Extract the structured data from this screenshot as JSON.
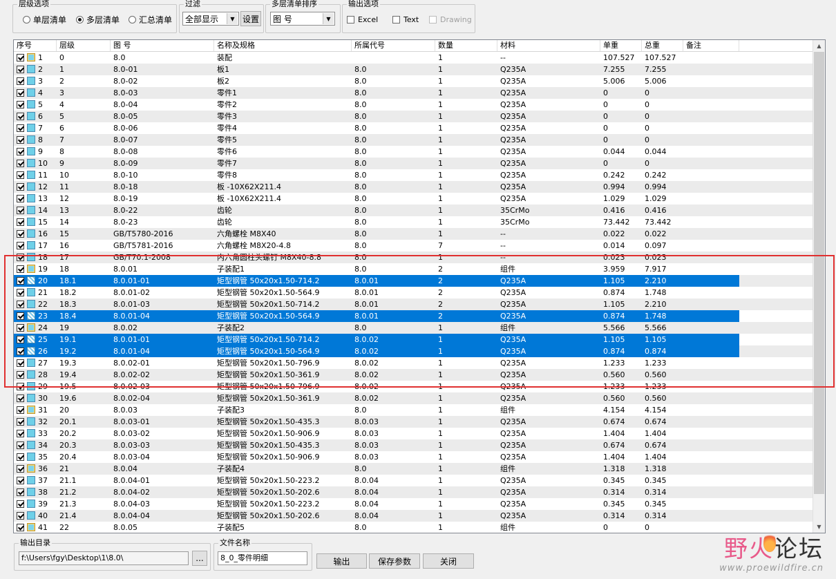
{
  "level_options": {
    "title": "层级选项",
    "options": [
      "单层清单",
      "多层清单",
      "汇总清单"
    ],
    "selected": "多层清单"
  },
  "filter": {
    "title": "过滤",
    "value": "全部显示",
    "button": "设置"
  },
  "sort": {
    "title": "多层清单排序",
    "value": "图 号"
  },
  "output_options": {
    "title": "输出选项",
    "items": [
      {
        "label": "Excel",
        "checked": false,
        "enabled": true
      },
      {
        "label": "Text",
        "checked": false,
        "enabled": true
      },
      {
        "label": "Drawing",
        "checked": false,
        "enabled": false
      }
    ]
  },
  "table": {
    "columns": [
      "序号",
      "层级",
      "图 号",
      "名称及规格",
      "所属代号",
      "数量",
      "材料",
      "单重",
      "总重",
      "备注"
    ],
    "rows": [
      {
        "no": "1",
        "level": "0",
        "dwg": "8.0",
        "name": "装配",
        "parent": "",
        "qty": "1",
        "mat": "--",
        "unit": "107.527",
        "total": "107.527",
        "note": "",
        "icon": "asm",
        "sel": false
      },
      {
        "no": "2",
        "level": "1",
        "dwg": "8.0-01",
        "name": "板1",
        "parent": "8.0",
        "qty": "1",
        "mat": "Q235A",
        "unit": "7.255",
        "total": "7.255",
        "note": "",
        "icon": "part",
        "sel": false
      },
      {
        "no": "3",
        "level": "2",
        "dwg": "8.0-02",
        "name": "板2",
        "parent": "8.0",
        "qty": "1",
        "mat": "Q235A",
        "unit": "5.006",
        "total": "5.006",
        "note": "",
        "icon": "part",
        "sel": false
      },
      {
        "no": "4",
        "level": "3",
        "dwg": "8.0-03",
        "name": "零件1",
        "parent": "8.0",
        "qty": "1",
        "mat": "Q235A",
        "unit": "0",
        "total": "0",
        "note": "",
        "icon": "part",
        "sel": false
      },
      {
        "no": "5",
        "level": "4",
        "dwg": "8.0-04",
        "name": "零件2",
        "parent": "8.0",
        "qty": "1",
        "mat": "Q235A",
        "unit": "0",
        "total": "0",
        "note": "",
        "icon": "part",
        "sel": false
      },
      {
        "no": "6",
        "level": "5",
        "dwg": "8.0-05",
        "name": "零件3",
        "parent": "8.0",
        "qty": "1",
        "mat": "Q235A",
        "unit": "0",
        "total": "0",
        "note": "",
        "icon": "part",
        "sel": false
      },
      {
        "no": "7",
        "level": "6",
        "dwg": "8.0-06",
        "name": "零件4",
        "parent": "8.0",
        "qty": "1",
        "mat": "Q235A",
        "unit": "0",
        "total": "0",
        "note": "",
        "icon": "part",
        "sel": false
      },
      {
        "no": "8",
        "level": "7",
        "dwg": "8.0-07",
        "name": "零件5",
        "parent": "8.0",
        "qty": "1",
        "mat": "Q235A",
        "unit": "0",
        "total": "0",
        "note": "",
        "icon": "part",
        "sel": false
      },
      {
        "no": "9",
        "level": "8",
        "dwg": "8.0-08",
        "name": "零件6",
        "parent": "8.0",
        "qty": "1",
        "mat": "Q235A",
        "unit": "0.044",
        "total": "0.044",
        "note": "",
        "icon": "part",
        "sel": false
      },
      {
        "no": "10",
        "level": "9",
        "dwg": "8.0-09",
        "name": "零件7",
        "parent": "8.0",
        "qty": "1",
        "mat": "Q235A",
        "unit": "0",
        "total": "0",
        "note": "",
        "icon": "part",
        "sel": false
      },
      {
        "no": "11",
        "level": "10",
        "dwg": "8.0-10",
        "name": "零件8",
        "parent": "8.0",
        "qty": "1",
        "mat": "Q235A",
        "unit": "0.242",
        "total": "0.242",
        "note": "",
        "icon": "part",
        "sel": false
      },
      {
        "no": "12",
        "level": "11",
        "dwg": "8.0-18",
        "name": "板 -10X62X211.4",
        "parent": "8.0",
        "qty": "1",
        "mat": "Q235A",
        "unit": "0.994",
        "total": "0.994",
        "note": "",
        "icon": "part",
        "sel": false
      },
      {
        "no": "13",
        "level": "12",
        "dwg": "8.0-19",
        "name": "板 -10X62X211.4",
        "parent": "8.0",
        "qty": "1",
        "mat": "Q235A",
        "unit": "1.029",
        "total": "1.029",
        "note": "",
        "icon": "part",
        "sel": false
      },
      {
        "no": "14",
        "level": "13",
        "dwg": "8.0-22",
        "name": "齿轮",
        "parent": "8.0",
        "qty": "1",
        "mat": "35CrMo",
        "unit": "0.416",
        "total": "0.416",
        "note": "",
        "icon": "part",
        "sel": false
      },
      {
        "no": "15",
        "level": "14",
        "dwg": "8.0-23",
        "name": "齿轮",
        "parent": "8.0",
        "qty": "1",
        "mat": "35CrMo",
        "unit": "73.442",
        "total": "73.442",
        "note": "",
        "icon": "part",
        "sel": false
      },
      {
        "no": "16",
        "level": "15",
        "dwg": "GB/T5780-2016",
        "name": "六角螺栓 M8X40",
        "parent": "8.0",
        "qty": "1",
        "mat": "--",
        "unit": "0.022",
        "total": "0.022",
        "note": "",
        "icon": "part",
        "sel": false
      },
      {
        "no": "17",
        "level": "16",
        "dwg": "GB/T5781-2016",
        "name": "六角螺栓 M8X20-4.8",
        "parent": "8.0",
        "qty": "7",
        "mat": "--",
        "unit": "0.014",
        "total": "0.097",
        "note": "",
        "icon": "part",
        "sel": false
      },
      {
        "no": "18",
        "level": "17",
        "dwg": "GB/T70.1-2008",
        "name": "内六角圆柱头螺钉 M8X40-8.8",
        "parent": "8.0",
        "qty": "1",
        "mat": "--",
        "unit": "0.023",
        "total": "0.023",
        "note": "",
        "icon": "part",
        "sel": false
      },
      {
        "no": "19",
        "level": "18",
        "dwg": "8.0.01",
        "name": "子装配1",
        "parent": "8.0",
        "qty": "2",
        "mat": "组件",
        "unit": "3.959",
        "total": "7.917",
        "note": "",
        "icon": "asm",
        "sel": false
      },
      {
        "no": "20",
        "level": "18.1",
        "dwg": "8.0.01-01",
        "name": "矩型钢管 50x20x1.50-714.2",
        "parent": "8.0.01",
        "qty": "2",
        "mat": "Q235A",
        "unit": "1.105",
        "total": "2.210",
        "note": "",
        "icon": "part",
        "sel": true
      },
      {
        "no": "21",
        "level": "18.2",
        "dwg": "8.0.01-02",
        "name": "矩型钢管 50x20x1.50-564.9",
        "parent": "8.0.01",
        "qty": "2",
        "mat": "Q235A",
        "unit": "0.874",
        "total": "1.748",
        "note": "",
        "icon": "part",
        "sel": false
      },
      {
        "no": "22",
        "level": "18.3",
        "dwg": "8.0.01-03",
        "name": "矩型钢管 50x20x1.50-714.2",
        "parent": "8.0.01",
        "qty": "2",
        "mat": "Q235A",
        "unit": "1.105",
        "total": "2.210",
        "note": "",
        "icon": "part",
        "sel": false
      },
      {
        "no": "23",
        "level": "18.4",
        "dwg": "8.0.01-04",
        "name": "矩型钢管 50x20x1.50-564.9",
        "parent": "8.0.01",
        "qty": "2",
        "mat": "Q235A",
        "unit": "0.874",
        "total": "1.748",
        "note": "",
        "icon": "part",
        "sel": true
      },
      {
        "no": "24",
        "level": "19",
        "dwg": "8.0.02",
        "name": "子装配2",
        "parent": "8.0",
        "qty": "1",
        "mat": "组件",
        "unit": "5.566",
        "total": "5.566",
        "note": "",
        "icon": "asm",
        "sel": false
      },
      {
        "no": "25",
        "level": "19.1",
        "dwg": "8.0.01-01",
        "name": "矩型钢管 50x20x1.50-714.2",
        "parent": "8.0.02",
        "qty": "1",
        "mat": "Q235A",
        "unit": "1.105",
        "total": "1.105",
        "note": "",
        "icon": "part",
        "sel": true
      },
      {
        "no": "26",
        "level": "19.2",
        "dwg": "8.0.01-04",
        "name": "矩型钢管 50x20x1.50-564.9",
        "parent": "8.0.02",
        "qty": "1",
        "mat": "Q235A",
        "unit": "0.874",
        "total": "0.874",
        "note": "",
        "icon": "part",
        "sel": true
      },
      {
        "no": "27",
        "level": "19.3",
        "dwg": "8.0.02-01",
        "name": "矩型钢管 50x20x1.50-796.9",
        "parent": "8.0.02",
        "qty": "1",
        "mat": "Q235A",
        "unit": "1.233",
        "total": "1.233",
        "note": "",
        "icon": "part",
        "sel": false
      },
      {
        "no": "28",
        "level": "19.4",
        "dwg": "8.0.02-02",
        "name": "矩型钢管 50x20x1.50-361.9",
        "parent": "8.0.02",
        "qty": "1",
        "mat": "Q235A",
        "unit": "0.560",
        "total": "0.560",
        "note": "",
        "icon": "part",
        "sel": false
      },
      {
        "no": "29",
        "level": "19.5",
        "dwg": "8.0.02-03",
        "name": "矩型钢管 50x20x1.50-796.9",
        "parent": "8.0.02",
        "qty": "1",
        "mat": "Q235A",
        "unit": "1.233",
        "total": "1.233",
        "note": "",
        "icon": "part",
        "sel": false
      },
      {
        "no": "30",
        "level": "19.6",
        "dwg": "8.0.02-04",
        "name": "矩型钢管 50x20x1.50-361.9",
        "parent": "8.0.02",
        "qty": "1",
        "mat": "Q235A",
        "unit": "0.560",
        "total": "0.560",
        "note": "",
        "icon": "part",
        "sel": false
      },
      {
        "no": "31",
        "level": "20",
        "dwg": "8.0.03",
        "name": "子装配3",
        "parent": "8.0",
        "qty": "1",
        "mat": "组件",
        "unit": "4.154",
        "total": "4.154",
        "note": "",
        "icon": "asm",
        "sel": false
      },
      {
        "no": "32",
        "level": "20.1",
        "dwg": "8.0.03-01",
        "name": "矩型钢管 50x20x1.50-435.3",
        "parent": "8.0.03",
        "qty": "1",
        "mat": "Q235A",
        "unit": "0.674",
        "total": "0.674",
        "note": "",
        "icon": "part",
        "sel": false
      },
      {
        "no": "33",
        "level": "20.2",
        "dwg": "8.0.03-02",
        "name": "矩型钢管 50x20x1.50-906.9",
        "parent": "8.0.03",
        "qty": "1",
        "mat": "Q235A",
        "unit": "1.404",
        "total": "1.404",
        "note": "",
        "icon": "part",
        "sel": false
      },
      {
        "no": "34",
        "level": "20.3",
        "dwg": "8.0.03-03",
        "name": "矩型钢管 50x20x1.50-435.3",
        "parent": "8.0.03",
        "qty": "1",
        "mat": "Q235A",
        "unit": "0.674",
        "total": "0.674",
        "note": "",
        "icon": "part",
        "sel": false
      },
      {
        "no": "35",
        "level": "20.4",
        "dwg": "8.0.03-04",
        "name": "矩型钢管 50x20x1.50-906.9",
        "parent": "8.0.03",
        "qty": "1",
        "mat": "Q235A",
        "unit": "1.404",
        "total": "1.404",
        "note": "",
        "icon": "part",
        "sel": false
      },
      {
        "no": "36",
        "level": "21",
        "dwg": "8.0.04",
        "name": "子装配4",
        "parent": "8.0",
        "qty": "1",
        "mat": "组件",
        "unit": "1.318",
        "total": "1.318",
        "note": "",
        "icon": "asm",
        "sel": false
      },
      {
        "no": "37",
        "level": "21.1",
        "dwg": "8.0.04-01",
        "name": "矩型钢管 50x20x1.50-223.2",
        "parent": "8.0.04",
        "qty": "1",
        "mat": "Q235A",
        "unit": "0.345",
        "total": "0.345",
        "note": "",
        "icon": "part",
        "sel": false
      },
      {
        "no": "38",
        "level": "21.2",
        "dwg": "8.0.04-02",
        "name": "矩型钢管 50x20x1.50-202.6",
        "parent": "8.0.04",
        "qty": "1",
        "mat": "Q235A",
        "unit": "0.314",
        "total": "0.314",
        "note": "",
        "icon": "part",
        "sel": false
      },
      {
        "no": "39",
        "level": "21.3",
        "dwg": "8.0.04-03",
        "name": "矩型钢管 50x20x1.50-223.2",
        "parent": "8.0.04",
        "qty": "1",
        "mat": "Q235A",
        "unit": "0.345",
        "total": "0.345",
        "note": "",
        "icon": "part",
        "sel": false
      },
      {
        "no": "40",
        "level": "21.4",
        "dwg": "8.0.04-04",
        "name": "矩型钢管 50x20x1.50-202.6",
        "parent": "8.0.04",
        "qty": "1",
        "mat": "Q235A",
        "unit": "0.314",
        "total": "0.314",
        "note": "",
        "icon": "part",
        "sel": false
      },
      {
        "no": "41",
        "level": "22",
        "dwg": "8.0.05",
        "name": "子装配5",
        "parent": "8.0",
        "qty": "1",
        "mat": "组件",
        "unit": "0",
        "total": "0",
        "note": "",
        "icon": "asm",
        "sel": false
      }
    ]
  },
  "output_dir": {
    "title": "输出目录",
    "value": "f:\\Users\\fgy\\Desktop\\1\\8.0\\",
    "browse": "..."
  },
  "file_name": {
    "title": "文件名称",
    "value": "8_0_零件明细"
  },
  "buttons": {
    "export": "输出",
    "save_params": "保存参数",
    "close": "关闭"
  },
  "watermark": {
    "title_pink": "野火",
    "title_dark": "论坛",
    "url": "www.proewildfire.cn"
  },
  "colors": {
    "selection": "#0078d7",
    "highlight_box": "#e03030"
  }
}
